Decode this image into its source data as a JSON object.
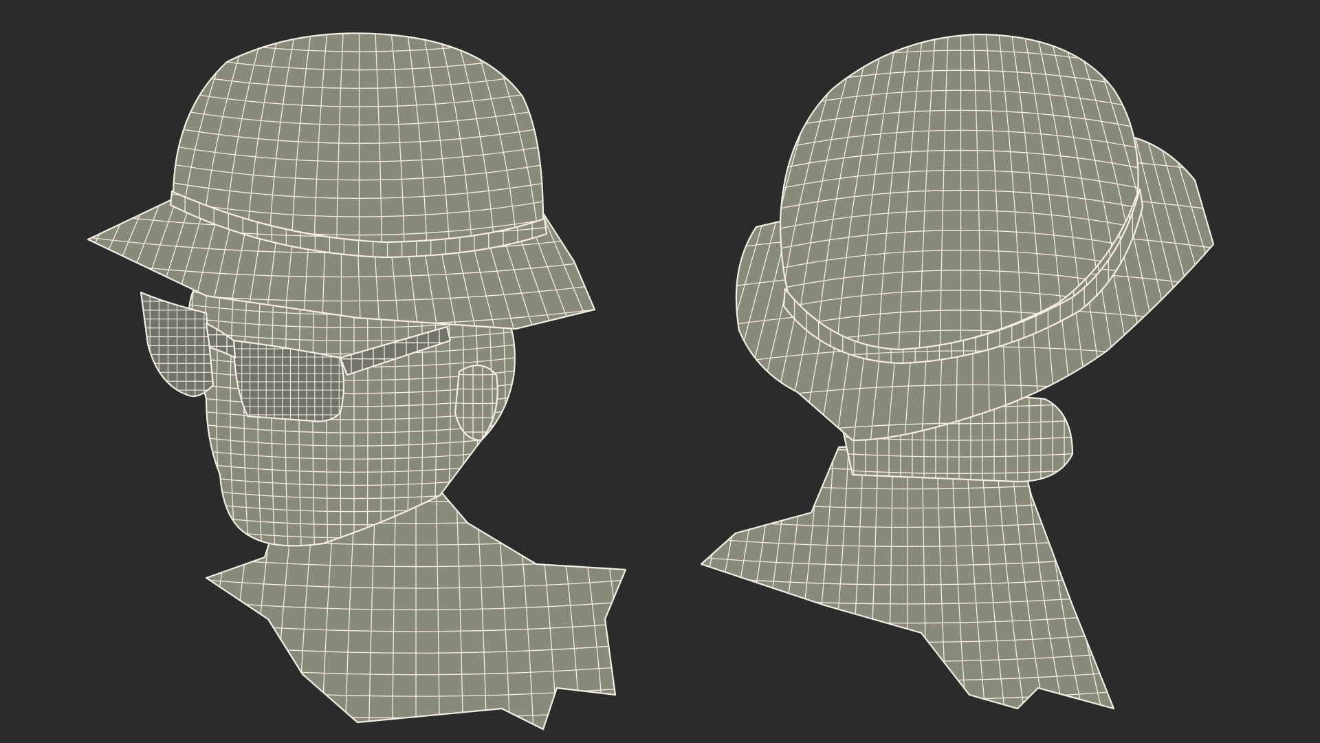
{
  "scene": {
    "background_color": "#2b2b2b",
    "mesh_fill_color": "#8a8a7a",
    "wire_color": "#f2f0e6",
    "lens_fill_color": "#73736a",
    "shadow_color": "#3a3a35",
    "models": [
      {
        "label": "",
        "view": "front-three-quarter",
        "accessories": [
          "bucket-hat-icon",
          "sunglasses-icon"
        ]
      },
      {
        "label": "",
        "view": "back-three-quarter",
        "accessories": [
          "bucket-hat-icon"
        ]
      }
    ]
  }
}
